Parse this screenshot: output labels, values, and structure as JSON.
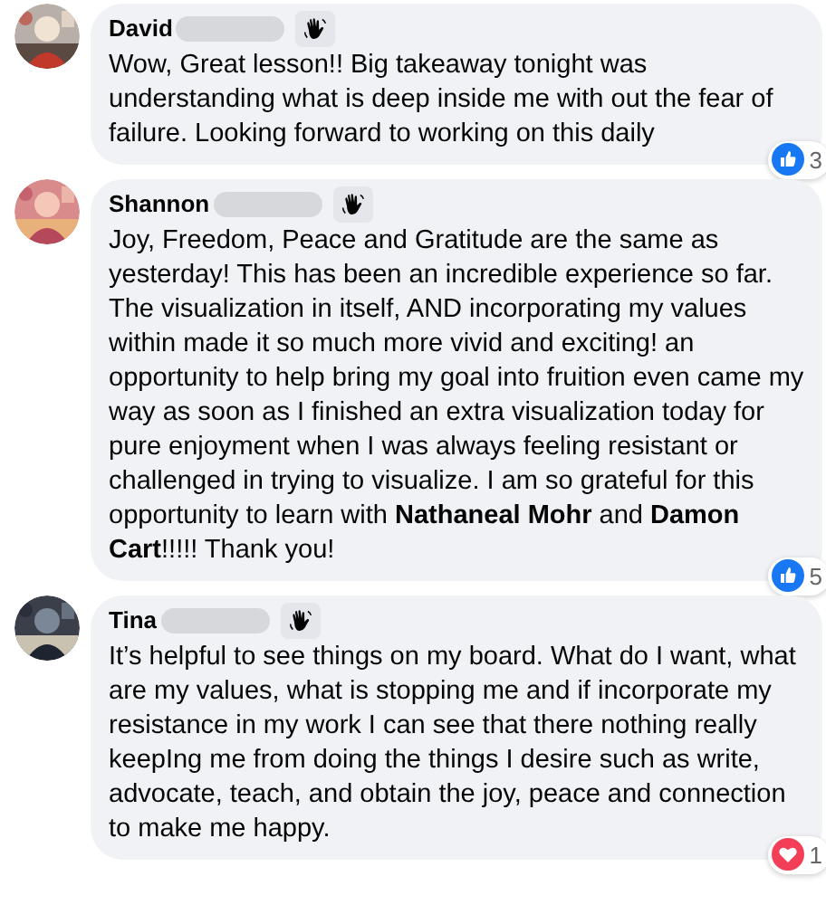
{
  "comments": [
    {
      "author": "David",
      "text": "Wow, Great lesson!! Big takeaway tonight was understanding what is deep inside me with out the fear of failure. Looking forward to working on this daily",
      "reaction": {
        "kind": "like",
        "count": "3"
      }
    },
    {
      "author": "Shannon",
      "text": "Joy, Freedom, Peace and Gratitude are the same as yesterday! This has been an incredible experience so far. The visualization in itself, AND incorporating my values within made it so much more vivid and exciting! an opportunity to help bring my goal into fruition even came my way as soon as I finished an extra visualization today for pure enjoyment when I was always feeling resistant or challenged in trying to visualize. I am so grateful for this opportunity to learn with **Nathaneal Mohr** and **Damon Cart**!!!!! Thank you!",
      "reaction": {
        "kind": "like",
        "count": "5"
      }
    },
    {
      "author": "Tina",
      "text": "It’s helpful to see things on my board. What do I want, what are my values, what is stopping me and if incorporate my resistance in my work I can see that there nothing really keepIng me from doing the things I desire such as write, advocate, teach, and obtain the joy, peace and connection to make me happy.",
      "reaction": {
        "kind": "love",
        "count": "1"
      }
    }
  ]
}
